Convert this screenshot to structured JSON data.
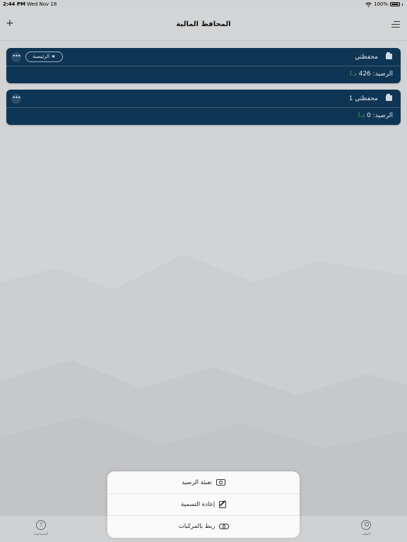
{
  "status_bar": {
    "time": "2:44 PM",
    "date": "Wed Nov 18",
    "battery": "100%"
  },
  "nav": {
    "title": "المحافظ المالية",
    "add_symbol": "+"
  },
  "wallets": [
    {
      "name": "محفظتي",
      "balance_label": "الرصيد:",
      "balance_value": "426",
      "currency": "د.ا",
      "badge": "★ الرئيسية",
      "more": "•••"
    },
    {
      "name": "محفظتي 1",
      "balance_label": "الرصيد:",
      "balance_value": "0",
      "currency": "د.ا",
      "more": "•••"
    }
  ],
  "action_sheet": {
    "items": [
      {
        "label": "تعبئة الرصيد",
        "icon": "money-icon"
      },
      {
        "label": "إعادة التسمية",
        "icon": "edit-icon"
      },
      {
        "label": "ربط بالمركبات",
        "icon": "link-icon"
      }
    ]
  },
  "tab_bar": {
    "left_label": "المساعدة",
    "right_label": "الملف"
  },
  "colors": {
    "card_bg": "#0f3554",
    "currency_green": "#39b54a",
    "overlay_gray": "#d2d3d4"
  }
}
